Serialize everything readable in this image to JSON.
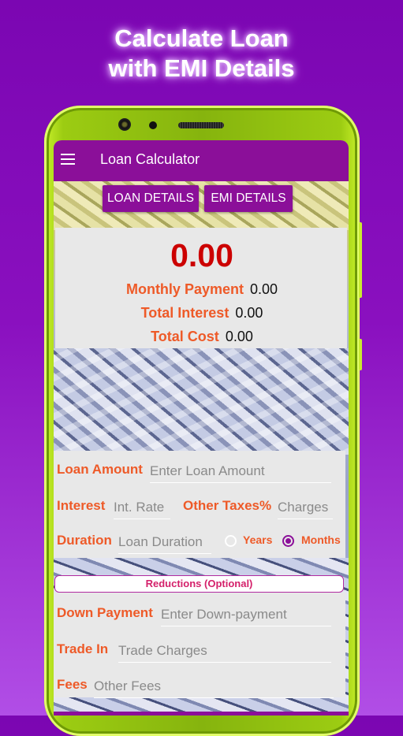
{
  "promo": {
    "line1": "Calculate Loan",
    "line2": "with EMI Details"
  },
  "appbar": {
    "menu_icon": "hamburger-menu-icon",
    "title": "Loan Calculator"
  },
  "tabs": [
    {
      "label": "LOAN DETAILS"
    },
    {
      "label": "EMI DETAILS"
    }
  ],
  "results": {
    "emi_value": "0.00",
    "monthly_payment": {
      "label": "Monthly Payment",
      "value": "0.00"
    },
    "total_interest": {
      "label": "Total Interest",
      "value": "0.00"
    },
    "total_cost": {
      "label": "Total Cost",
      "value": "0.00"
    }
  },
  "form": {
    "loan_amount": {
      "label": "Loan Amount",
      "placeholder": "Enter Loan Amount",
      "value": ""
    },
    "interest": {
      "label": "Interest",
      "placeholder": "Int. Rate",
      "value": ""
    },
    "other_taxes": {
      "label": "Other Taxes%",
      "placeholder": "Charges",
      "value": ""
    },
    "duration": {
      "label": "Duration",
      "placeholder": "Loan Duration",
      "value": ""
    },
    "duration_unit": {
      "options": [
        "Years",
        "Months"
      ],
      "selected": "Months"
    }
  },
  "reductions": {
    "title": "Reductions (Optional)",
    "down_payment": {
      "label": "Down Payment",
      "placeholder": "Enter Down-payment",
      "value": ""
    },
    "trade_in": {
      "label": "Trade In",
      "placeholder": "Trade Charges",
      "value": ""
    },
    "fees": {
      "label": "Fees",
      "placeholder": "Other Fees",
      "value": ""
    }
  },
  "colors": {
    "primary": "#8b0f99",
    "label_orange": "#ee5a28",
    "result_red": "#cc0000",
    "reductions_text": "#d4206a",
    "phone_frame": "#9ccc12"
  }
}
